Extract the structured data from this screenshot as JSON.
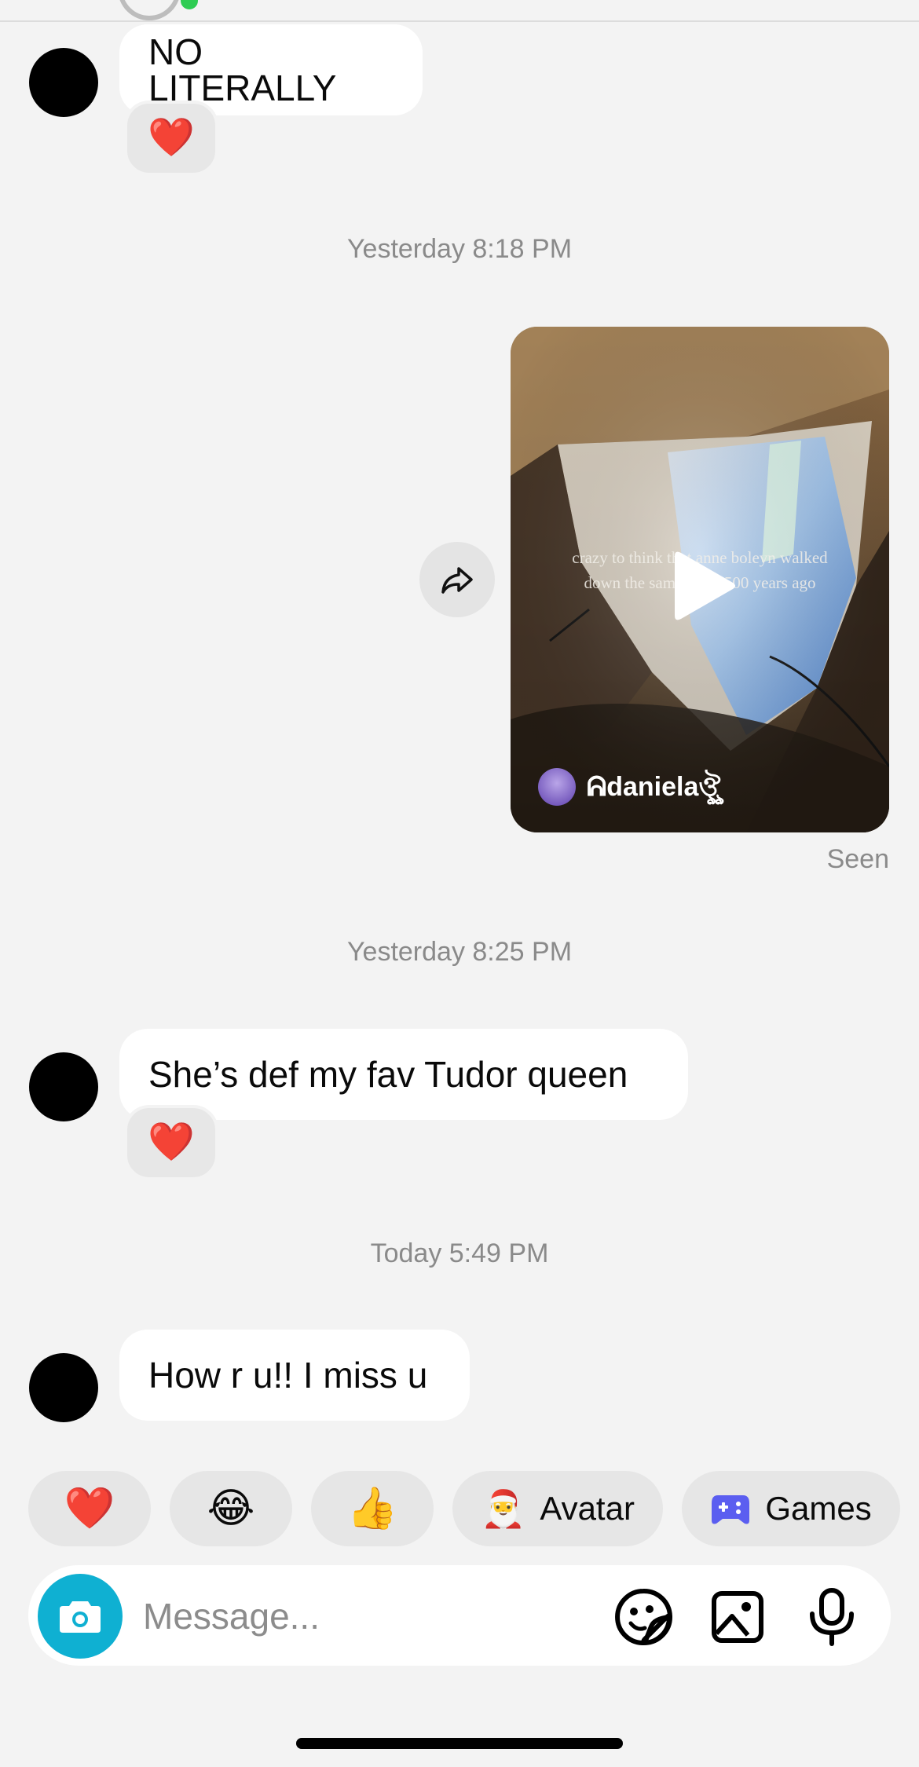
{
  "messages": [
    {
      "type": "incoming",
      "text": "NO LITERALLY",
      "reaction": "❤️"
    },
    {
      "type": "timestamp",
      "text": "Yesterday 8:18 PM"
    },
    {
      "type": "shared_video",
      "caption": "crazy to think that anne boleyn walked down the same steps 500 years ago",
      "author": "ᕱdanielaঔৣ",
      "status": "Seen"
    },
    {
      "type": "timestamp",
      "text": "Yesterday 8:25 PM"
    },
    {
      "type": "incoming",
      "text": "She’s def my fav Tudor queen",
      "reaction": "❤️"
    },
    {
      "type": "timestamp",
      "text": "Today 5:49 PM"
    },
    {
      "type": "incoming",
      "text": "How r u!! I miss u"
    }
  ],
  "quick_replies": [
    {
      "emoji": "❤️"
    },
    {
      "emoji": "😂"
    },
    {
      "emoji": "👍"
    },
    {
      "emoji": "🎅",
      "label": "Avatar"
    },
    {
      "icon": "gamepad-icon",
      "label": "Games"
    }
  ],
  "composer": {
    "placeholder": "Message...",
    "value": "",
    "icons": [
      "camera-icon",
      "sticker-icon",
      "gallery-icon",
      "microphone-icon"
    ]
  },
  "colors": {
    "background": "#f3f3f3",
    "bubble": "#ffffff",
    "camera_button": "#0fb0d2",
    "games_icon": "#5b5ef0",
    "heart": "#e8202e"
  }
}
